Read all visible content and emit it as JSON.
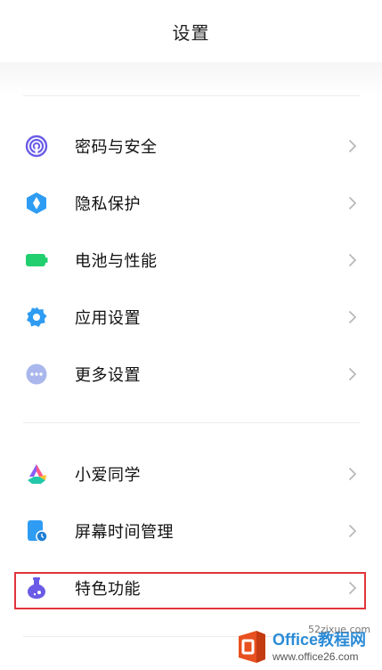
{
  "header": {
    "title": "设置"
  },
  "groups": [
    {
      "items": [
        {
          "label": "密码与安全",
          "icon": "fingerprint-icon"
        },
        {
          "label": "隐私保护",
          "icon": "privacy-shield-icon"
        },
        {
          "label": "电池与性能",
          "icon": "battery-icon"
        },
        {
          "label": "应用设置",
          "icon": "gear-icon"
        },
        {
          "label": "更多设置",
          "icon": "more-dots-icon"
        }
      ]
    },
    {
      "items": [
        {
          "label": "小爱同学",
          "icon": "xiaoai-icon"
        },
        {
          "label": "屏幕时间管理",
          "icon": "screen-time-icon"
        },
        {
          "label": "特色功能",
          "icon": "flask-icon"
        }
      ]
    }
  ],
  "watermark": {
    "title": "Office教程网",
    "subtitle": "www.office26.com",
    "overlay": "52zixue.com"
  },
  "colors": {
    "highlight_border": "#e0353b",
    "chevron": "#b5b5b5"
  }
}
